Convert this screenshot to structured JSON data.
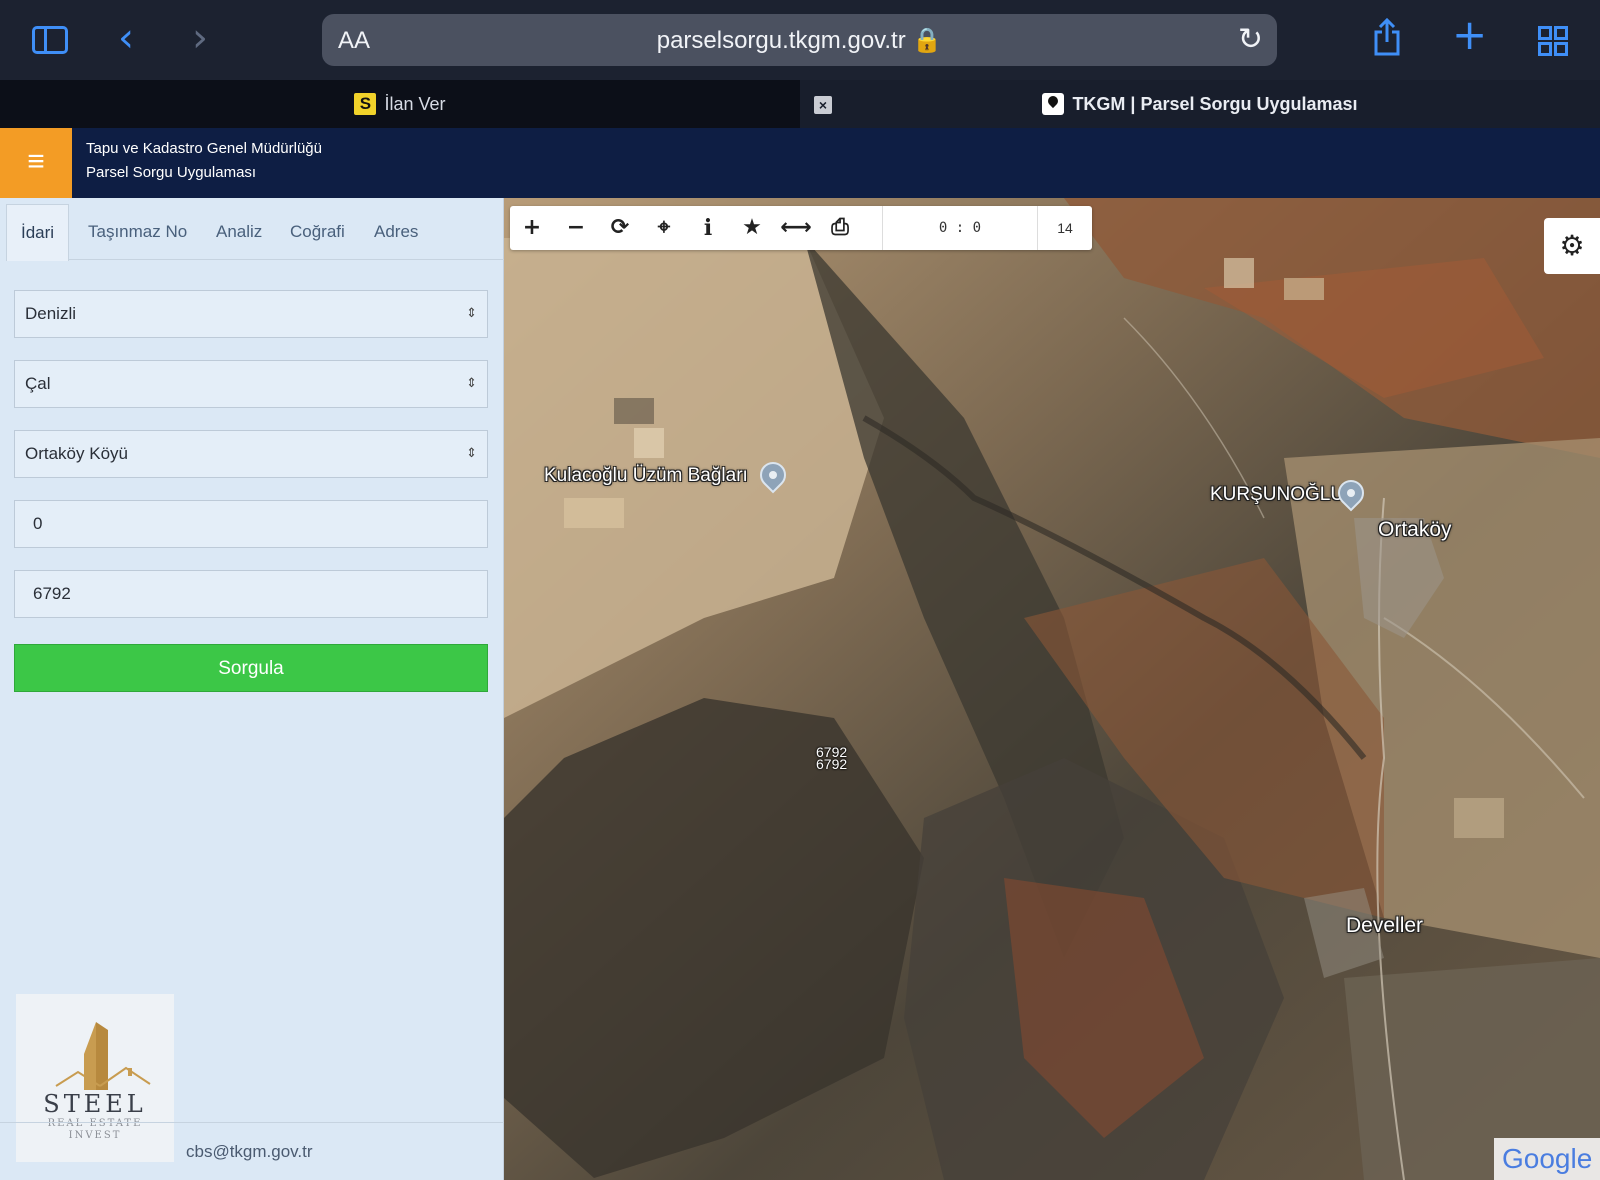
{
  "browser": {
    "address_aa": "AA",
    "url": "parselsorgu.tkgm.gov.tr 🔒",
    "icons": [
      "sidebar-icon",
      "back-chevron-icon",
      "forward-chevron-icon",
      "reload-icon",
      "share-icon",
      "plus-icon",
      "tabs-grid-icon"
    ]
  },
  "tabs": {
    "active": {
      "favicon": "S",
      "title": "İlan Ver"
    },
    "inactive": {
      "close": "×",
      "title": "TKGM | Parsel Sorgu Uygulaması"
    }
  },
  "app": {
    "menu_icon": "≡",
    "org_name": "Tapu ve Kadastro Genel Müdürlüğü",
    "app_name": "Parsel Sorgu Uygulaması"
  },
  "panel": {
    "tabs": [
      "İdari",
      "Taşınmaz No",
      "Analiz",
      "Coğrafi",
      "Adres"
    ],
    "il": "Denizli",
    "ilce": "Çal",
    "mahalle": "Ortaköy Köyü",
    "ada": "0",
    "parsel": "6792",
    "submit_label": "Sorgula",
    "email": "cbs@tkgm.gov.tr",
    "logo": {
      "word": "STEEL",
      "sub1": "REAL ESTATE",
      "sub2": "INVEST"
    }
  },
  "map": {
    "toolbar": {
      "zoom_in": "+",
      "zoom_out": "−",
      "refresh": "⟳",
      "locate": "⌖",
      "info": "i",
      "favorite": "★",
      "measure": "⟷",
      "print": "⎙",
      "coords": "0 : 0",
      "zoom_level": "14"
    },
    "settings_icon": "⚙",
    "labels": {
      "kulacoglu": "Kulacoğlu Üzüm Bağları",
      "kursunoglu": "KURŞUNOĞLU",
      "ortakoy": "Ortaköy",
      "develler": "Develler",
      "parcel_a": "6792",
      "parcel_b": "6792"
    },
    "attribution": "Google",
    "colors": {
      "terrain_dark": "#3f3a30",
      "terrain_mid": "#7c6a52",
      "terrain_light": "#c4ad8a",
      "terrain_red": "#8d4a2e"
    }
  }
}
